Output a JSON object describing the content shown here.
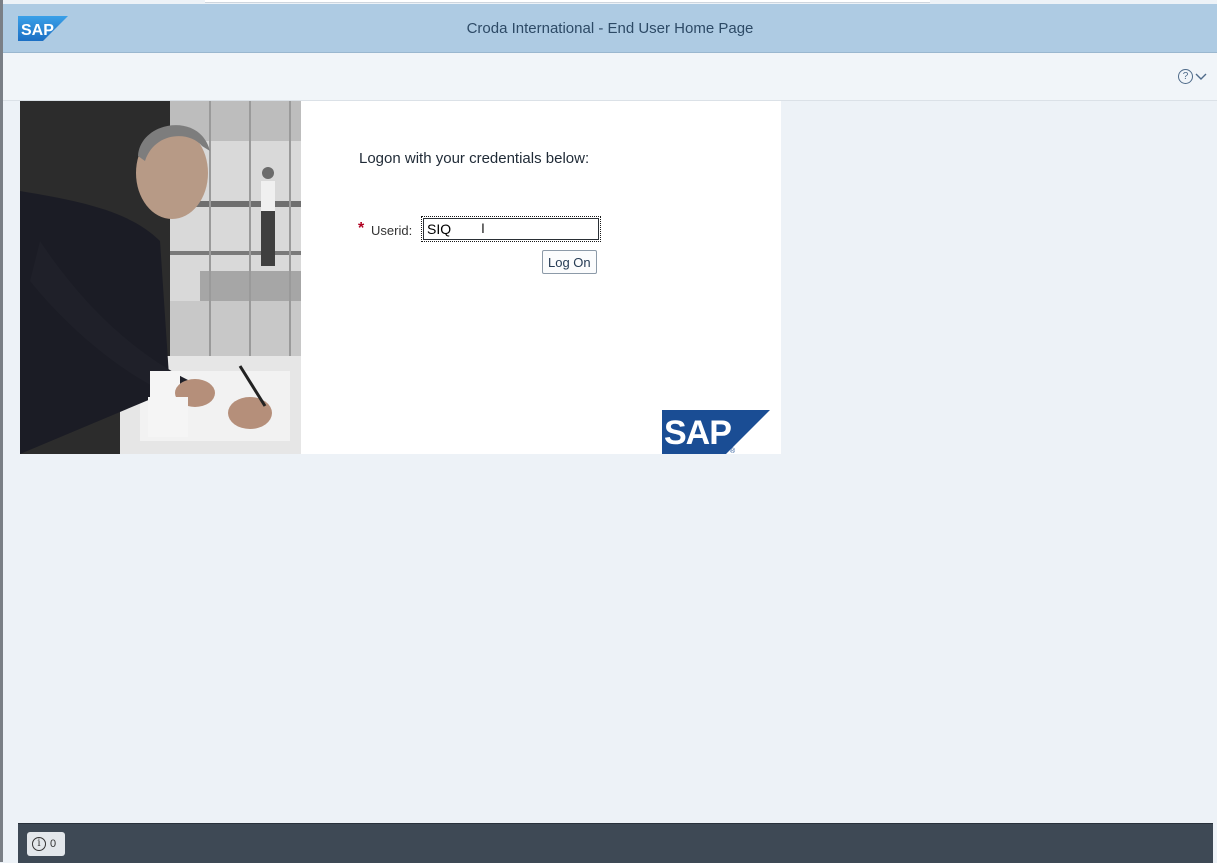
{
  "header": {
    "logo_text": "SAP",
    "title": "Croda International - End User Home Page",
    "help_icon": "help-icon"
  },
  "logon": {
    "instruction": "Logon with your credentials below:",
    "required_marker": "*",
    "userid_label": "Userid:",
    "userid_value": "SIQ",
    "logon_button": "Log On",
    "brand_logo_text": "SAP"
  },
  "footer": {
    "message_icon": "info-icon",
    "message_count": "0"
  },
  "colors": {
    "shell_header": "#aecbe3",
    "sap_blue": "#1a4d94",
    "background": "#edf2f7",
    "footer": "#3e4955"
  }
}
